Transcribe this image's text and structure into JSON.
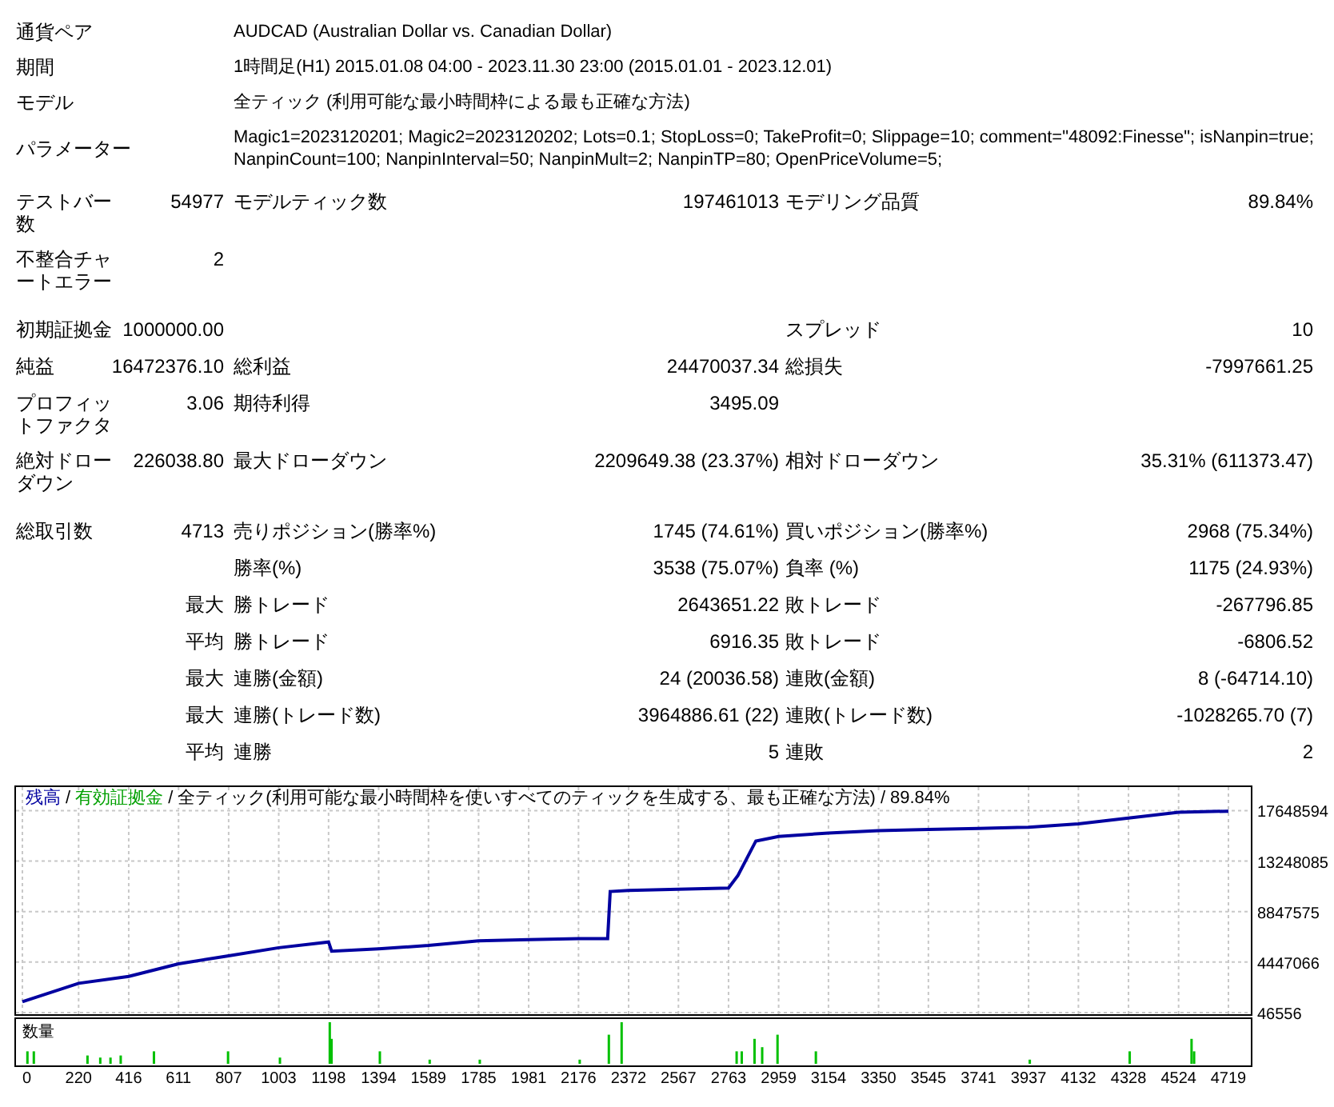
{
  "header": [
    {
      "label": "通貨ペア",
      "value": "AUDCAD (Australian Dollar vs. Canadian Dollar)"
    },
    {
      "label": "期間",
      "value": "1時間足(H1) 2015.01.08 04:00 - 2023.11.30 23:00 (2015.01.01 - 2023.12.01)"
    },
    {
      "label": "モデル",
      "value": "全ティック (利用可能な最小時間枠による最も正確な方法)"
    },
    {
      "label": "パラメーター",
      "value": "Magic1=2023120201; Magic2=2023120202; Lots=0.1; StopLoss=0; TakeProfit=0; Slippage=10; comment=\"48092:Finesse\"; isNanpin=true; NanpinCount=100; NanpinInterval=50; NanpinMult=2; NanpinTP=80; OpenPriceVolume=5;"
    }
  ],
  "sections": [
    [
      {
        "label_1": "テストバー数",
        "value_1": "54977",
        "label_2": "モデルティック数",
        "value_2": "197461013",
        "label_3": "モデリング品質",
        "value_3": "89.84%"
      },
      {
        "label_1": "不整合チャートエラー",
        "value_1": "2"
      }
    ],
    [
      {
        "label_1": "初期証拠金",
        "value_1": "1000000.00",
        "label_3": "スプレッド",
        "value_3": "10"
      },
      {
        "label_1": "純益",
        "value_1": "16472376.10",
        "label_2": "総利益",
        "value_2": "24470037.34",
        "label_3": "総損失",
        "value_3": "-7997661.25"
      },
      {
        "label_1": "プロフィットファクタ",
        "value_1": "3.06",
        "label_2": "期待利得",
        "value_2": "3495.09"
      },
      {
        "label_1": "絶対ドローダウン",
        "value_1": "226038.80",
        "label_2": "最大ドローダウン",
        "value_2": "2209649.38 (23.37%)",
        "label_3": "相対ドローダウン",
        "value_3": "35.31% (611373.47)"
      }
    ],
    [
      {
        "label_1": "総取引数",
        "value_1": "4713",
        "label_2": "売りポジション(勝率%)",
        "value_2": "1745 (74.61%)",
        "label_3": "買いポジション(勝率%)",
        "value_3": "2968 (75.34%)"
      },
      {
        "label_2": "勝率(%)",
        "value_2": "3538 (75.07%)",
        "label_3": "負率 (%)",
        "value_3": "1175 (24.93%)"
      },
      {
        "value_1": "最大",
        "label_2": "勝トレード",
        "value_2": "2643651.22",
        "label_3": "敗トレード",
        "value_3": "-267796.85"
      },
      {
        "value_1": "平均",
        "label_2": "勝トレード",
        "value_2": "6916.35",
        "label_3": "敗トレード",
        "value_3": "-6806.52"
      },
      {
        "value_1": "最大",
        "label_2": "連勝(金額)",
        "value_2": "24 (20036.58)",
        "label_3": "連敗(金額)",
        "value_3": "8 (-64714.10)"
      },
      {
        "value_1": "最大",
        "label_2": "連勝(トレード数)",
        "value_2": "3964886.61 (22)",
        "label_3": "連敗(トレード数)",
        "value_3": "-1028265.70 (7)"
      },
      {
        "value_1": "平均",
        "label_2": "連勝",
        "value_2": "5",
        "label_3": "連敗",
        "value_3": "2"
      }
    ]
  ],
  "chart": {
    "legend_separator": "/",
    "legend_items": [
      {
        "text": "有効証拠金",
        "color": "#00a000"
      }
    ],
    "legend_extra": [
      "全ティック(利用可能な最小時間枠を使いすべてのティックを生成する、最も正確な方法)",
      "89.84%"
    ],
    "volume_label": "数量",
    "chart_data": {
      "type": "line",
      "x": [
        0,
        220,
        416,
        611,
        807,
        1003,
        1198,
        1210,
        1394,
        1589,
        1785,
        1981,
        2176,
        2290,
        2300,
        2372,
        2567,
        2763,
        2800,
        2870,
        2959,
        3154,
        3350,
        3545,
        3741,
        3937,
        4132,
        4328,
        4524,
        4719
      ],
      "series": [
        {
          "name": "残高",
          "color": "#0000a0",
          "values": [
            1000000,
            2600000,
            3200000,
            4300000,
            5000000,
            5700000,
            6200000,
            5400000,
            5600000,
            5900000,
            6300000,
            6400000,
            6500000,
            6500000,
            10600000,
            10700000,
            10800000,
            10900000,
            12000000,
            15000000,
            15400000,
            15700000,
            15900000,
            16000000,
            16100000,
            16200000,
            16500000,
            17000000,
            17500000,
            17600000
          ]
        }
      ],
      "xlim": [
        0,
        4719
      ],
      "xticks": [
        0,
        220,
        416,
        611,
        807,
        1003,
        1198,
        1394,
        1589,
        1785,
        1981,
        2176,
        2372,
        2567,
        2763,
        2959,
        3154,
        3350,
        3545,
        3741,
        3937,
        4132,
        4328,
        4524,
        4719
      ],
      "ylim": [
        46556,
        19700000
      ],
      "grid": true,
      "yticks": [
        46556,
        4447066,
        8847575,
        13248085,
        17648594
      ]
    }
  }
}
